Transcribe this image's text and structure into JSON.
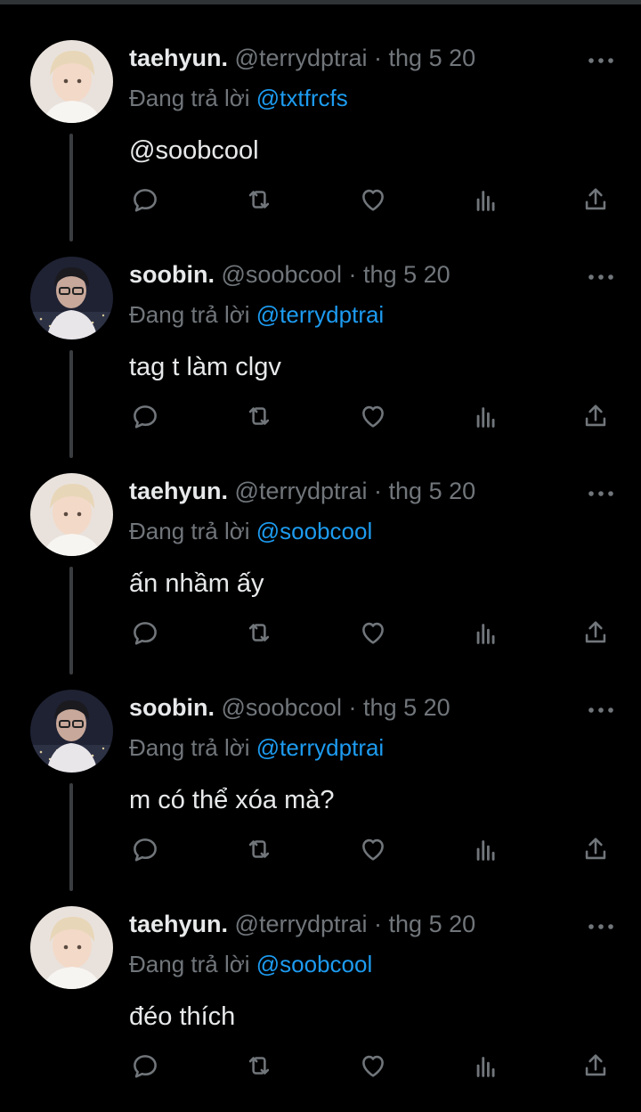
{
  "tweets": [
    {
      "name": "taehyun.",
      "handle": "@terrydptrai",
      "dot": "·",
      "date": "thg 5 20",
      "reply_prefix": "Đang trả lời ",
      "reply_to": "@txtfrcfs",
      "text": "@soobcool",
      "text_is_mention": true,
      "avatar": "taehyun-avatar"
    },
    {
      "name": "soobin.",
      "handle": "@soobcool",
      "dot": "·",
      "date": "thg 5 20",
      "reply_prefix": "Đang trả lời ",
      "reply_to": "@terrydptrai",
      "text": "tag t làm clgv",
      "text_is_mention": false,
      "avatar": "soobin-avatar"
    },
    {
      "name": "taehyun.",
      "handle": "@terrydptrai",
      "dot": "·",
      "date": "thg 5 20",
      "reply_prefix": "Đang trả lời ",
      "reply_to": "@soobcool",
      "text": "ấn nhầm ấy",
      "text_is_mention": false,
      "avatar": "taehyun-avatar"
    },
    {
      "name": "soobin.",
      "handle": "@soobcool",
      "dot": "·",
      "date": "thg 5 20",
      "reply_prefix": "Đang trả lời ",
      "reply_to": "@terrydptrai",
      "text": "m có thể xóa mà?",
      "text_is_mention": false,
      "avatar": "soobin-avatar"
    },
    {
      "name": "taehyun.",
      "handle": "@terrydptrai",
      "dot": "·",
      "date": "thg 5 20",
      "reply_prefix": "Đang trả lời ",
      "reply_to": "@soobcool",
      "text": "đéo thích",
      "text_is_mention": false,
      "avatar": "taehyun-avatar"
    }
  ],
  "action_icons": [
    "reply-icon",
    "retweet-icon",
    "like-icon",
    "views-icon",
    "share-icon"
  ],
  "colors": {
    "background": "#000000",
    "text": "#e7e9ea",
    "muted": "#71767b",
    "link": "#1d9bf0",
    "thread_line": "#3a3d40"
  }
}
